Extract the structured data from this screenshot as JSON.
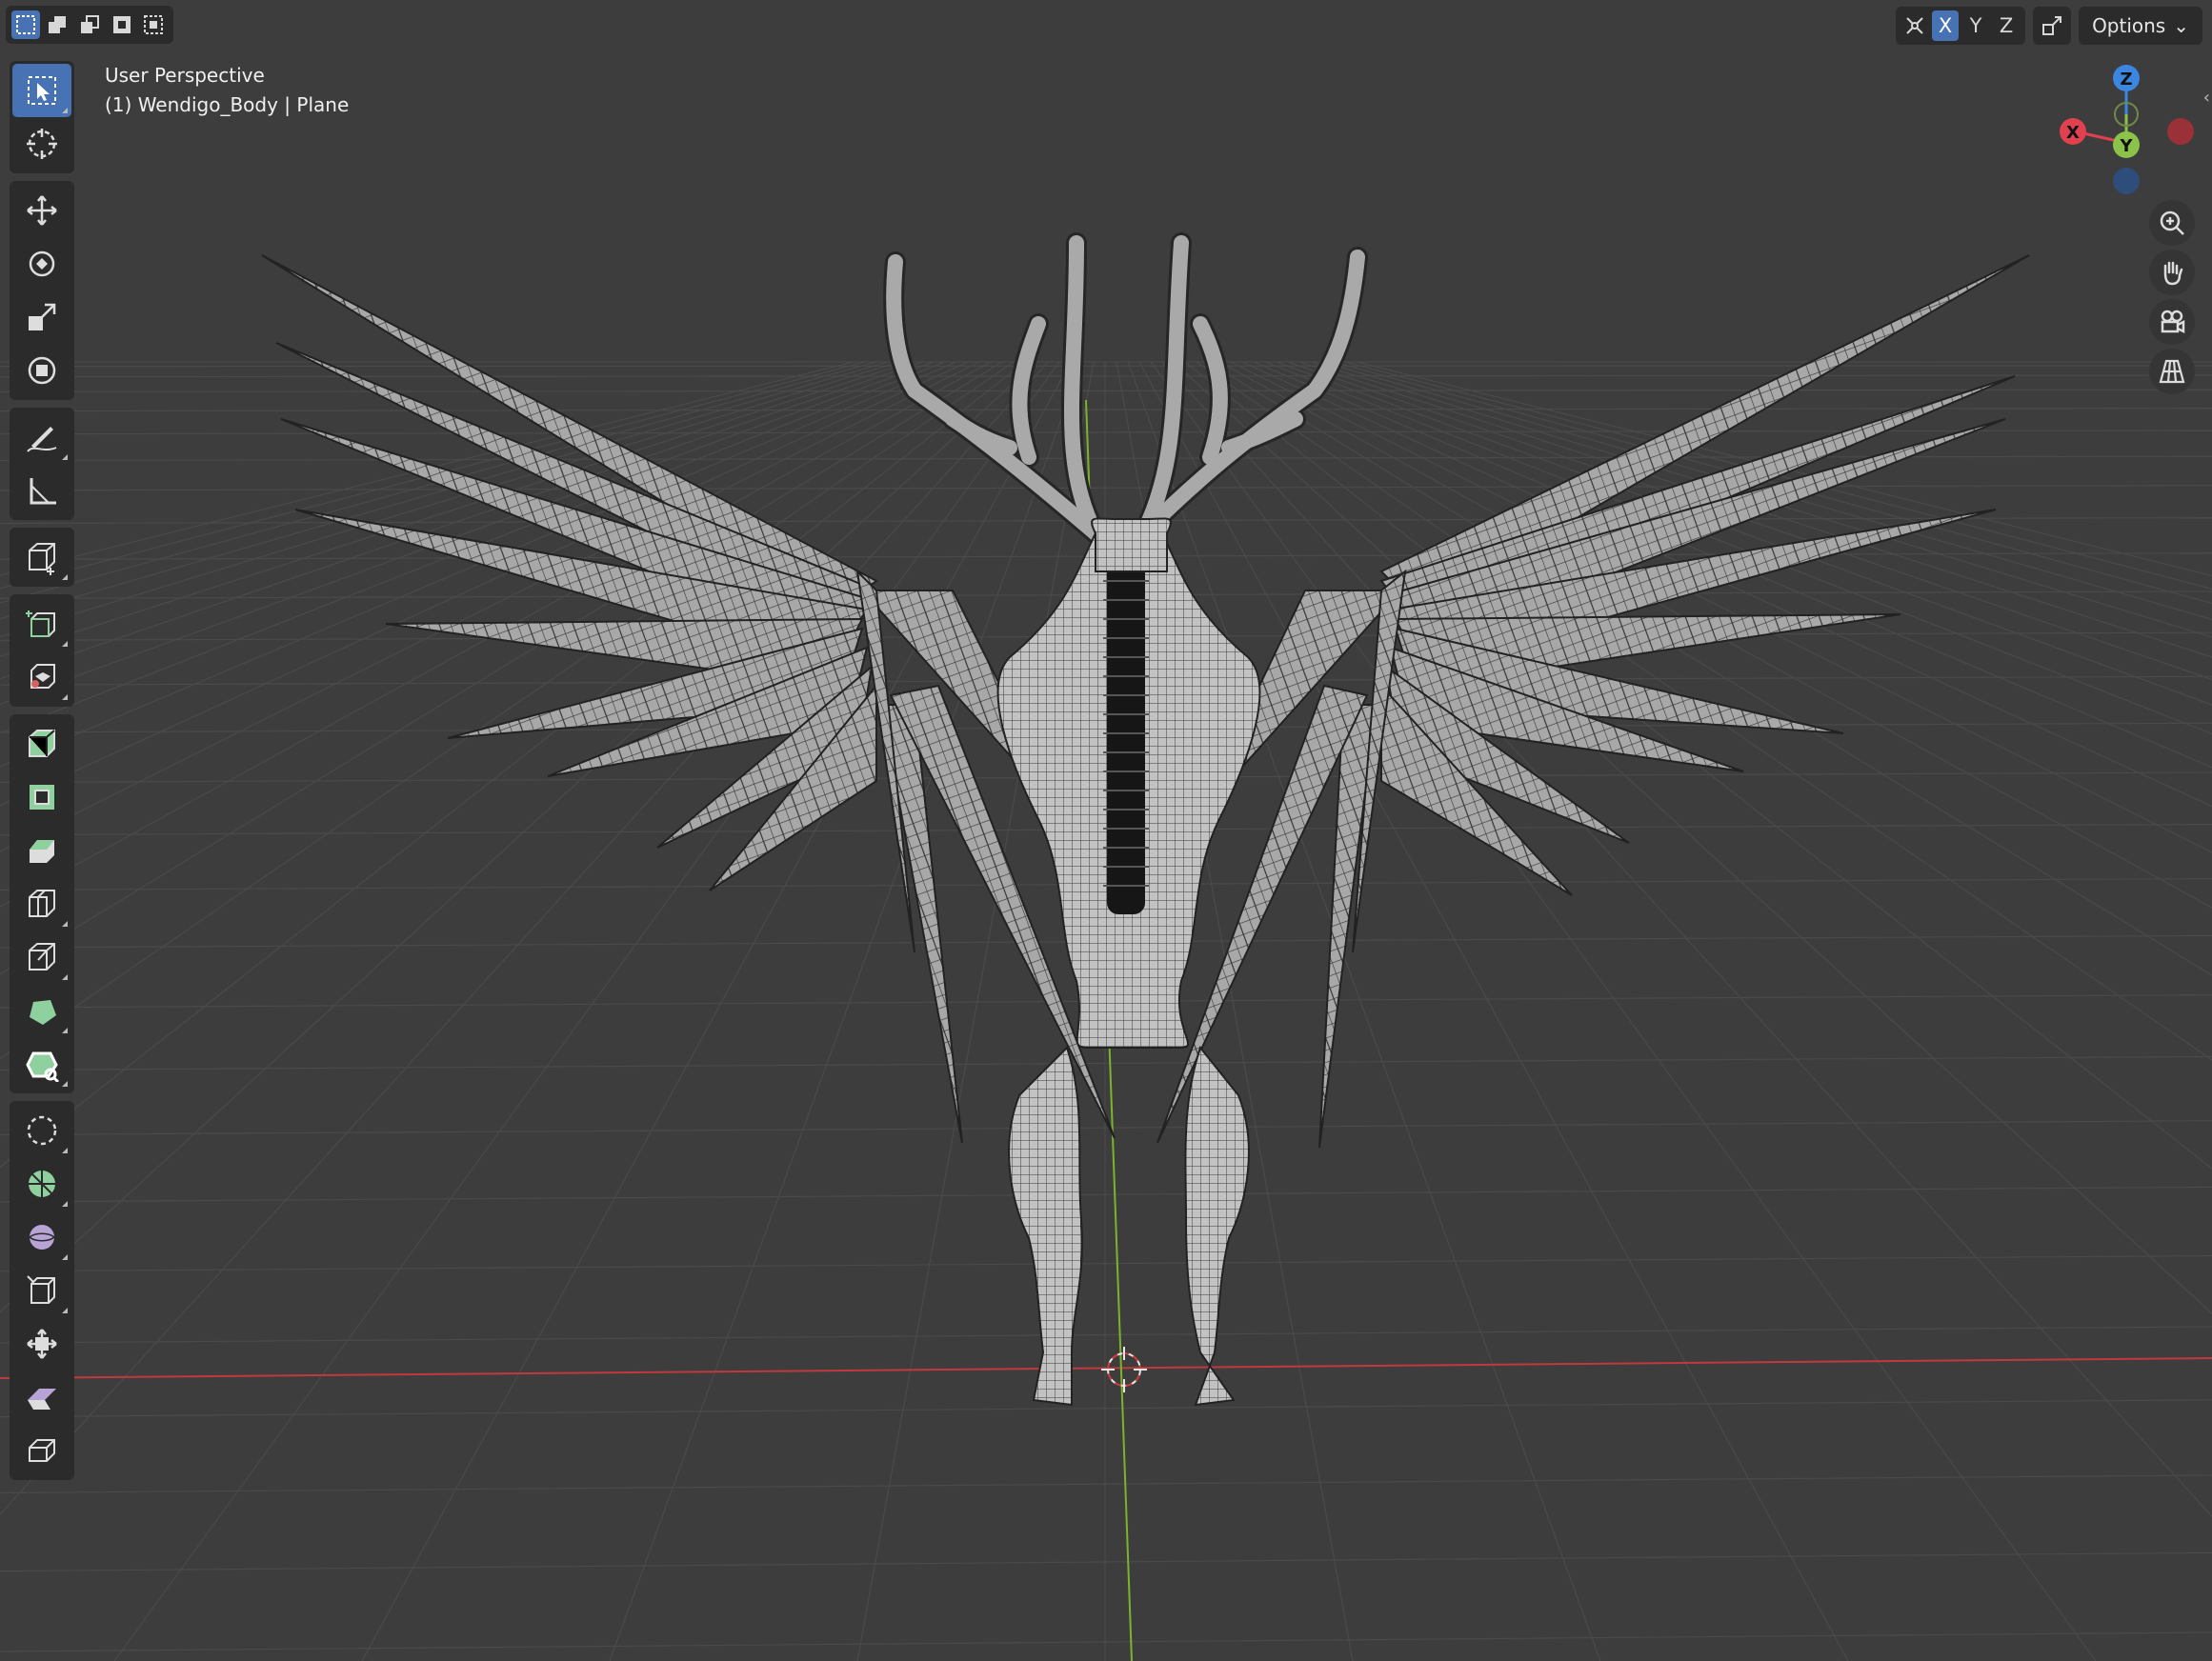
{
  "viewport": {
    "overlay": {
      "perspective_label": "User Perspective",
      "object_label": "(1) Wendigo_Body | Plane"
    },
    "background_color": "#3d3d3d",
    "grid_color": "#4a4a4a",
    "x_axis_color": "#c0393d",
    "y_axis_color": "#7bb42c"
  },
  "header": {
    "selection_modes": [
      "set-new-selection-icon",
      "extend-selection-icon",
      "subtract-selection-icon",
      "invert-selection-icon",
      "intersect-selection-icon"
    ],
    "mirror_axes": [
      "X",
      "Y",
      "Z"
    ],
    "options_label": "Options",
    "accent_color": "#4772b3"
  },
  "gizmo": {
    "z_label": "Z",
    "x_label": "X",
    "y_label": "Y",
    "colors": {
      "x": "#e0414f",
      "y": "#8bc34a",
      "z": "#3b86e0"
    }
  },
  "toolbar": {
    "tools": [
      "select-box-icon",
      "cursor-icon",
      "move-icon",
      "rotate-icon",
      "scale-icon",
      "transform-icon",
      "annotate-icon",
      "measure-icon",
      "add-cube-icon",
      "extrude-region-icon",
      "extrude-manifold-icon",
      "inset-faces-icon",
      "bevel-icon",
      "loop-cut-icon",
      "knife-icon",
      "poly-build-icon",
      "spin-icon",
      "smooth-icon",
      "randomize-icon",
      "edge-slide-icon",
      "shrink-fatten-icon",
      "shear-icon",
      "rip-region-icon",
      "push-pull-icon"
    ]
  },
  "navigation": [
    "zoom-icon",
    "pan-hand-icon",
    "camera-view-icon",
    "orthographic-grid-icon"
  ]
}
